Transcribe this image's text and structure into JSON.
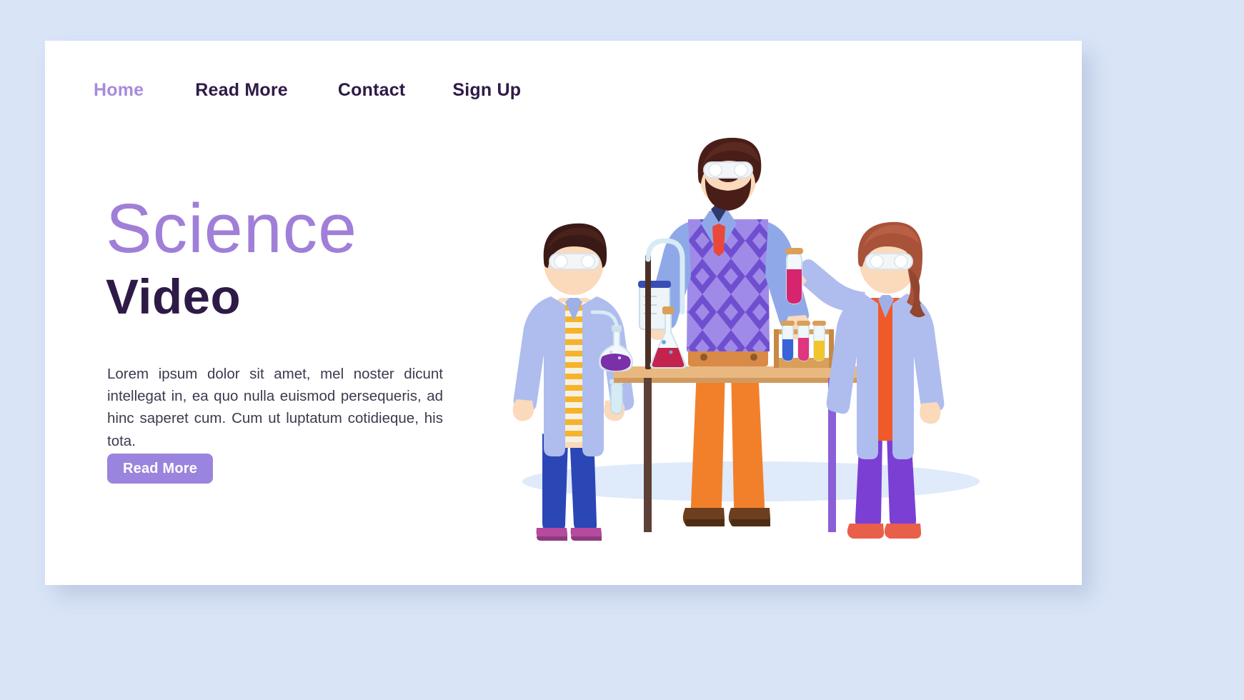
{
  "page": {
    "background_color": "#d9e4f7",
    "card_color": "#ffffff"
  },
  "nav": {
    "items": [
      {
        "label": "Home",
        "active": true
      },
      {
        "label": "Read More",
        "active": false
      },
      {
        "label": "Contact",
        "active": false
      },
      {
        "label": "Sign Up",
        "active": false
      }
    ]
  },
  "hero": {
    "title": "Science",
    "subtitle": "Video",
    "paragraph": "Lorem ipsum dolor sit amet, mel noster dicunt intellegat in, ea quo nulla euismod persequeris, ad hinc saperet cum. Cum ut luptatum cotidieque, his tota.",
    "cta_label": "Read More",
    "title_color": "#a07fd8",
    "subtitle_color": "#2e1a47",
    "cta_color": "#9b84dd"
  },
  "illustration": {
    "name": "science-lab-illustration",
    "description": "Teacher and two students in lab coats doing a chemistry experiment at a table",
    "colors": {
      "floor_shadow": "#dfeafb",
      "lab_coat": "#aebdee",
      "table_top": "#e8b880",
      "table_leg": "#5d4038",
      "teacher_pants": "#f2802b",
      "teacher_sweater": "#6f4fd0",
      "teacher_sweater_light": "#a08ae8",
      "teacher_shirt": "#8fa9e8",
      "teacher_hair": "#4a1e18",
      "tie": "#e8493a",
      "skin": "#fbd9bb",
      "boy_stripes": "#f5b32c",
      "boy_pants": "#2a47b5",
      "girl_hair": "#a8523a",
      "girl_shirt": "#ef5a2a",
      "girl_pants": "#7b3fd4",
      "flask_pink": "#d6246e",
      "flask_purple": "#7b2fa8",
      "flask_red": "#c4234e",
      "glass": "#d7ebf5"
    }
  }
}
